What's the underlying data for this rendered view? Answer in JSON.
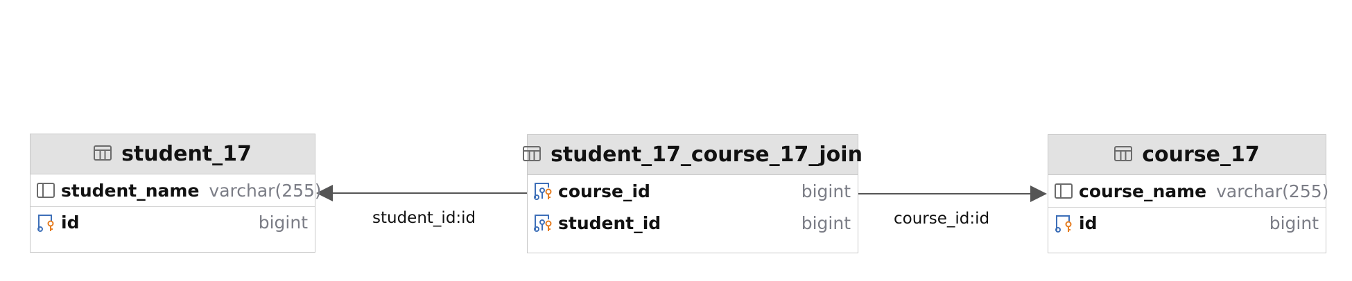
{
  "tables": {
    "student": {
      "name": "student_17",
      "columns": [
        {
          "name": "student_name",
          "type": "varchar(255)"
        },
        {
          "name": "id",
          "type": "bigint"
        }
      ]
    },
    "join": {
      "name": "student_17_course_17_join",
      "columns": [
        {
          "name": "course_id",
          "type": "bigint"
        },
        {
          "name": "student_id",
          "type": "bigint"
        }
      ]
    },
    "course": {
      "name": "course_17",
      "columns": [
        {
          "name": "course_name",
          "type": "varchar(255)"
        },
        {
          "name": "id",
          "type": "bigint"
        }
      ]
    }
  },
  "relations": [
    {
      "label": "student_id:id"
    },
    {
      "label": "course_id:id"
    }
  ],
  "icons": {
    "table": "table-icon",
    "column": "column-icon",
    "primary_key": "primary-key-icon",
    "foreign_key": "foreign-key-icon"
  },
  "colors": {
    "header_bg": "#e2e2e2",
    "border": "#c8c8c8",
    "type_text": "#7b7d86",
    "key_orange": "#e67e22",
    "key_blue": "#3d6fb8",
    "edge": "#555555"
  }
}
